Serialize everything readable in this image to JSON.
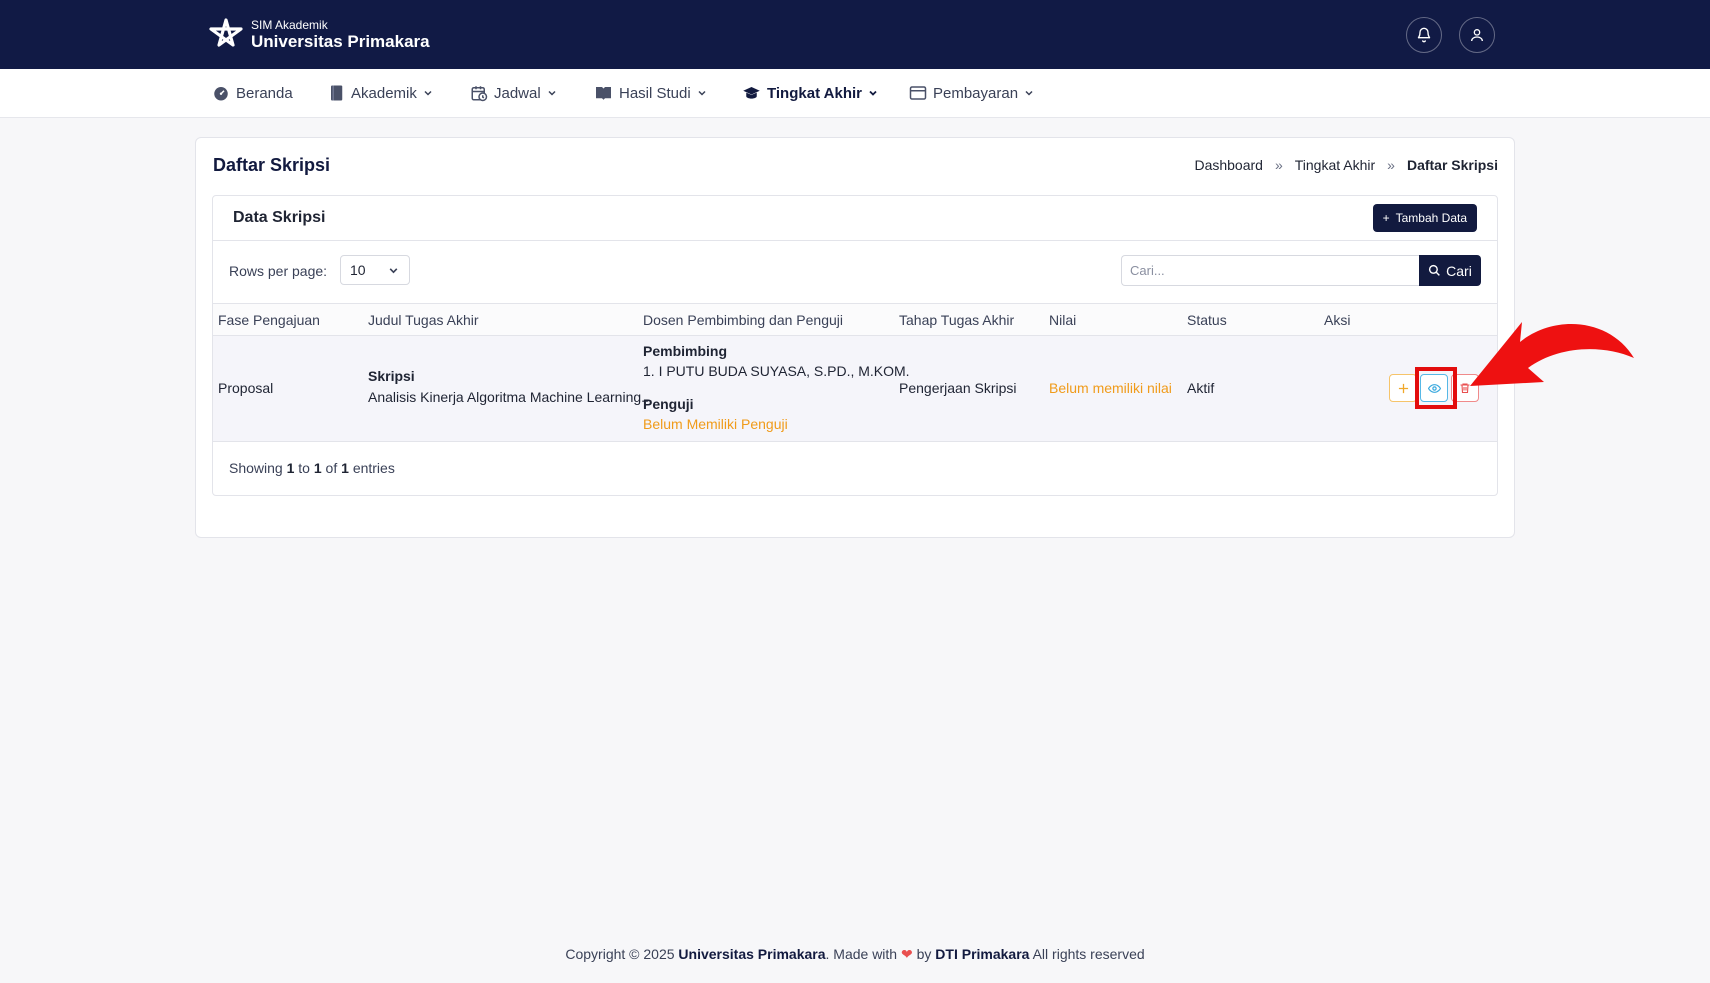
{
  "brand": {
    "subtitle": "SIM Akademik",
    "name": "Universitas Primakara"
  },
  "topbar": {
    "icons": [
      "bell-icon",
      "user-icon"
    ]
  },
  "nav": {
    "items": [
      {
        "label": "Beranda",
        "icon": "dashboard-icon",
        "dropdown": false
      },
      {
        "label": "Akademik",
        "icon": "book-icon",
        "dropdown": true
      },
      {
        "label": "Jadwal",
        "icon": "calendar-clock-icon",
        "dropdown": true
      },
      {
        "label": "Hasil Studi",
        "icon": "open-book-icon",
        "dropdown": true
      },
      {
        "label": "Tingkat Akhir",
        "icon": "graduation-cap-icon",
        "dropdown": true,
        "active": true
      },
      {
        "label": "Pembayaran",
        "icon": "credit-card-icon",
        "dropdown": true
      }
    ]
  },
  "page": {
    "title": "Daftar Skripsi",
    "breadcrumb": [
      "Dashboard",
      "Tingkat Akhir",
      "Daftar Skripsi"
    ],
    "breadcrumb_sep": "»"
  },
  "table_card": {
    "title": "Data Skripsi",
    "add_button": "Tambah Data",
    "rows_per_page_label": "Rows per page:",
    "rows_per_page_value": "10",
    "search_placeholder": "Cari...",
    "search_button": "Cari",
    "columns": [
      "Fase Pengajuan",
      "Judul Tugas Akhir",
      "Dosen Pembimbing dan Penguji",
      "Tahap Tugas Akhir",
      "Nilai",
      "Status",
      "Aksi"
    ],
    "rows": [
      {
        "fase": "Proposal",
        "judul_type": "Skripsi",
        "judul": "Analisis Kinerja Algoritma Machine Learning...",
        "pembimbing_label": "Pembimbing",
        "pembimbing": "1. I PUTU BUDA SUYASA, S.PD., M.KOM.",
        "penguji_label": "Penguji",
        "penguji": "Belum Memiliki Penguji",
        "tahap": "Pengerjaan Skripsi",
        "nilai": "Belum memiliki nilai",
        "status": "Aktif"
      }
    ],
    "showing": {
      "prefix": "Showing",
      "from": "1",
      "to_word": "to",
      "to": "1",
      "of_word": "of",
      "total": "1",
      "suffix": "entries"
    }
  },
  "footer": {
    "prefix": "Copyright © 2025",
    "org": "Universitas Primakara",
    "made_with": ". Made with",
    "by": "by",
    "team": "DTI Primakara",
    "suffix": "All rights reserved"
  },
  "colors": {
    "primary": "#111a45",
    "warning": "#f09b1a",
    "highlight": "#e30d0d",
    "info": "#56b8e6",
    "danger": "#f08a8a"
  }
}
